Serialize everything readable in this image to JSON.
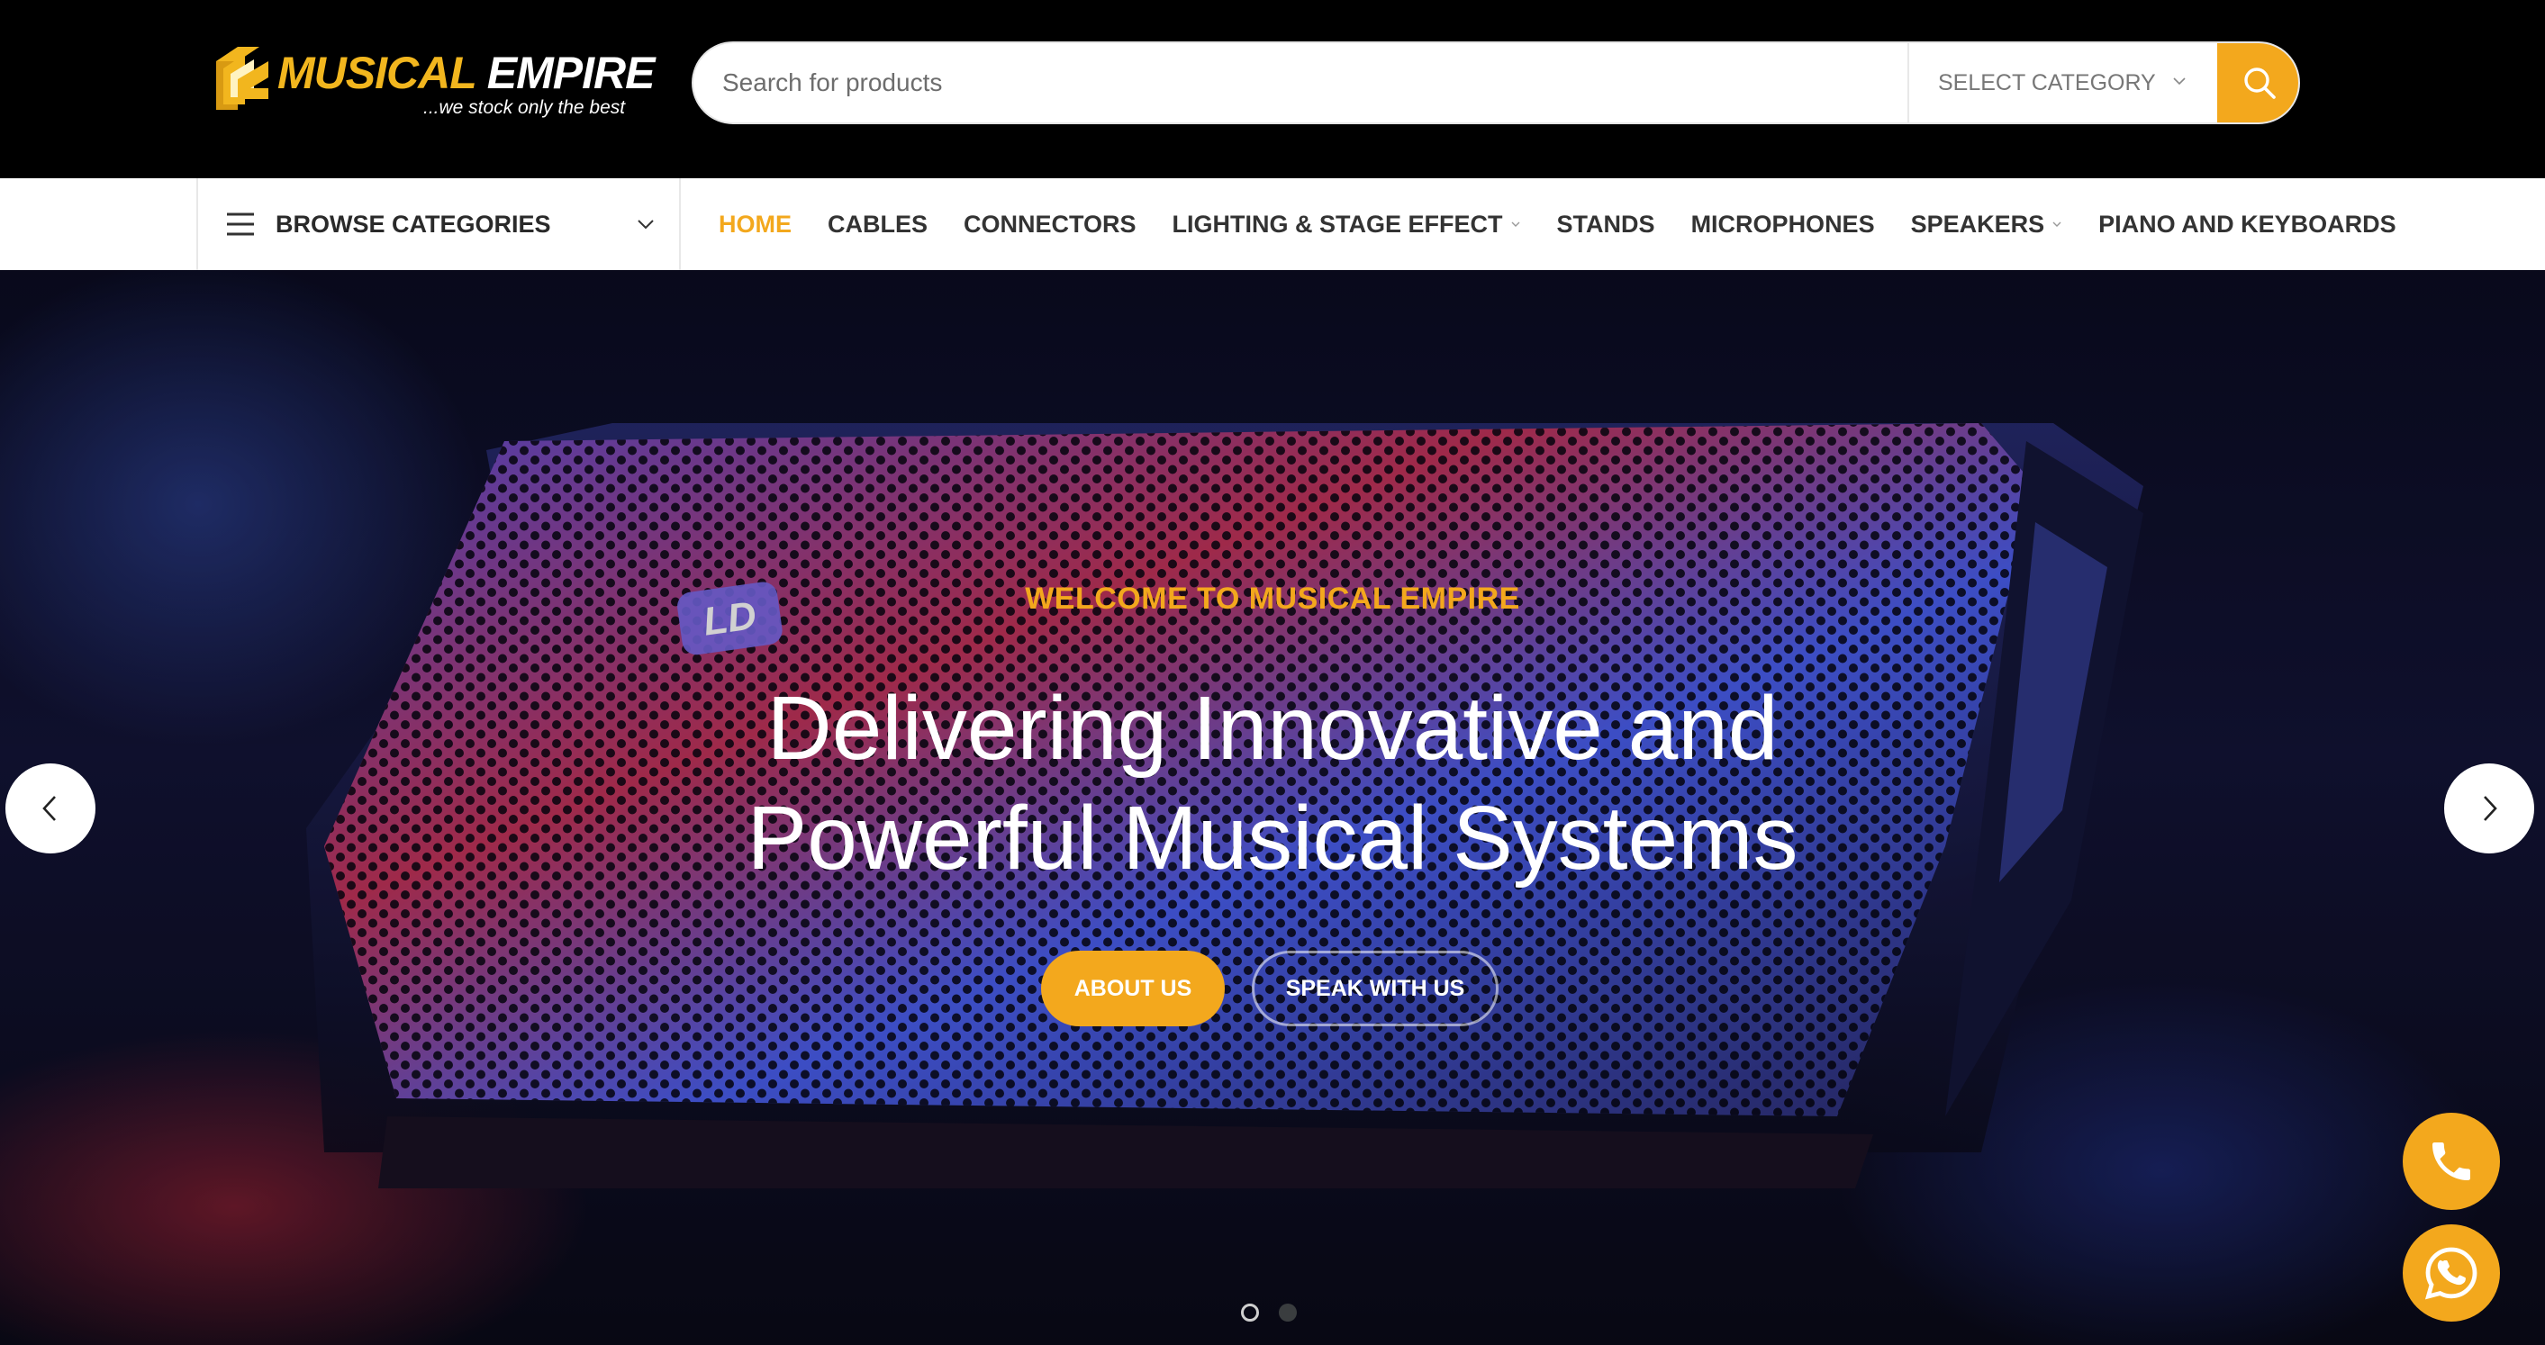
{
  "brand": {
    "name_part1": "MUSICAL",
    "name_part2": "EMPIRE",
    "tagline": "...we stock only the best",
    "colors": {
      "accent": "#f3a81d",
      "logo_gold": "#f2b61e",
      "header_bg": "#000000"
    }
  },
  "search": {
    "placeholder": "Search for products",
    "category_label": "SELECT CATEGORY",
    "button_icon": "search-icon"
  },
  "browse": {
    "label": "BROWSE CATEGORIES",
    "icon": "hamburger-icon"
  },
  "nav": {
    "items": [
      {
        "label": "HOME",
        "active": true,
        "has_dropdown": false
      },
      {
        "label": "CABLES",
        "active": false,
        "has_dropdown": false
      },
      {
        "label": "CONNECTORS",
        "active": false,
        "has_dropdown": false
      },
      {
        "label": "LIGHTING & STAGE EFFECT",
        "active": false,
        "has_dropdown": true
      },
      {
        "label": "STANDS",
        "active": false,
        "has_dropdown": false
      },
      {
        "label": "MICROPHONES",
        "active": false,
        "has_dropdown": false
      },
      {
        "label": "SPEAKERS",
        "active": false,
        "has_dropdown": true
      },
      {
        "label": "PIANO AND KEYBOARDS",
        "active": false,
        "has_dropdown": false
      }
    ]
  },
  "hero": {
    "kicker": "WELCOME TO MUSICAL EMPIRE",
    "title_line1": "Delivering Innovative and",
    "title_line2": "Powerful Musical Systems",
    "speaker_badge": "LD",
    "btn_primary": "ABOUT US",
    "btn_secondary": "SPEAK WITH US",
    "slides_total": 2,
    "slide_active": 1
  },
  "floating": {
    "phone_icon": "phone-icon",
    "whatsapp_icon": "whatsapp-icon"
  }
}
